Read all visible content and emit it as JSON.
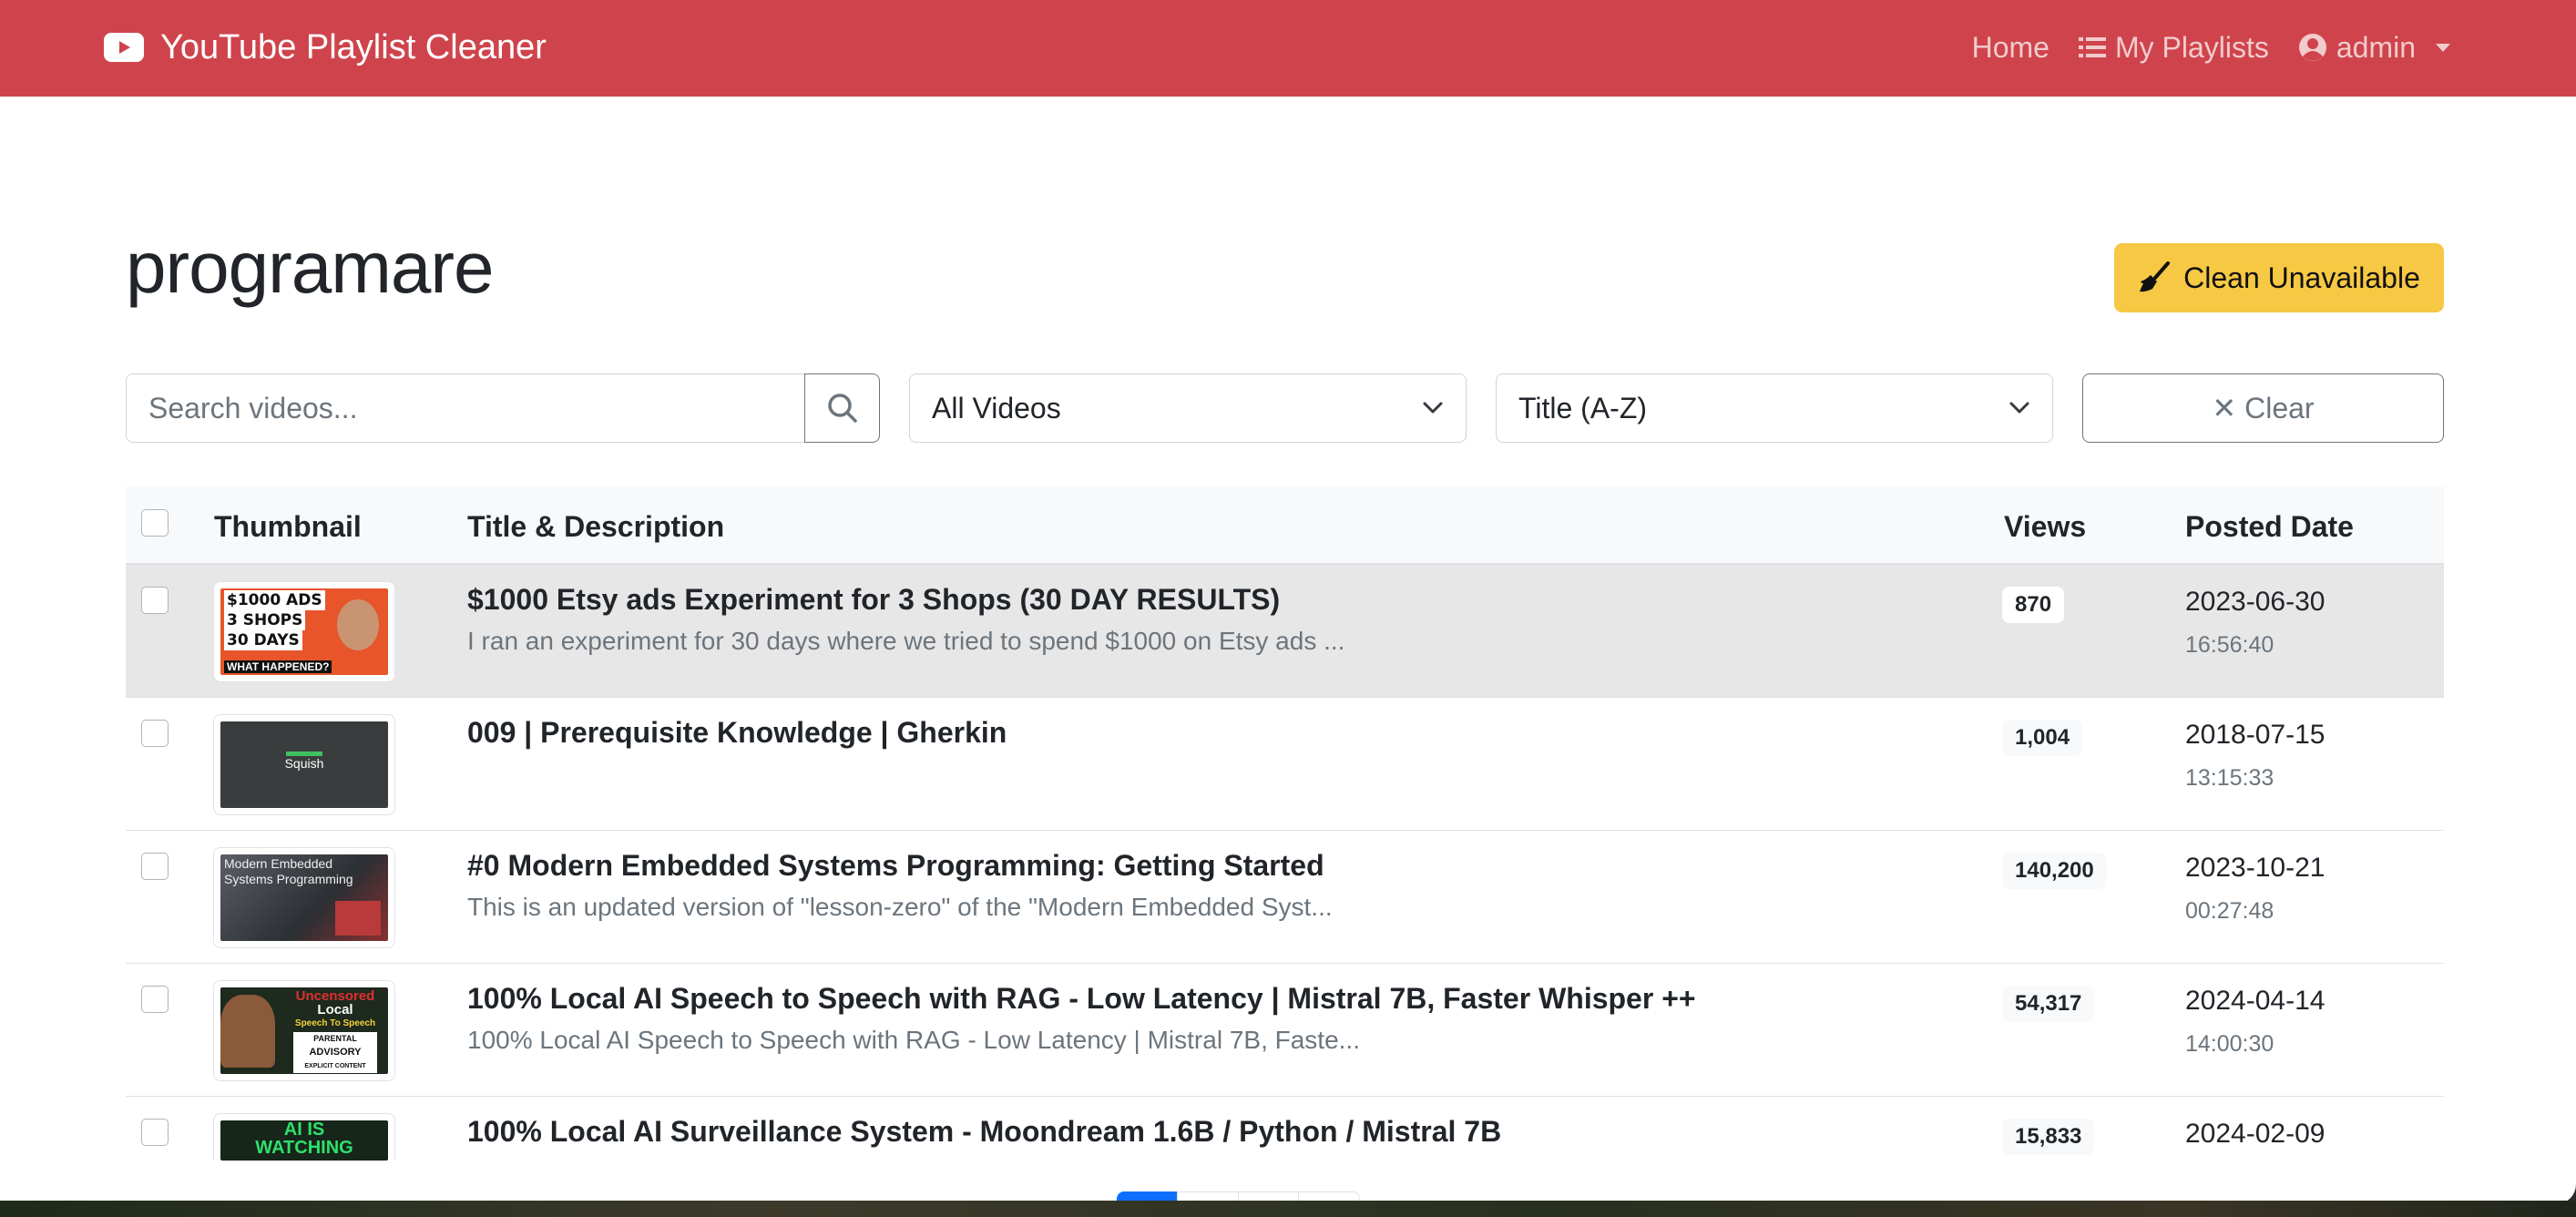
{
  "navbar": {
    "brand": "YouTube Playlist Cleaner",
    "home": "Home",
    "playlists": "My Playlists",
    "user": "admin"
  },
  "page": {
    "title": "programare",
    "clean_button": "Clean Unavailable"
  },
  "filters": {
    "search_placeholder": "Search videos...",
    "video_filter": "All Videos",
    "sort": "Title (A-Z)",
    "clear_button": "✕ Clear"
  },
  "table": {
    "headers": {
      "thumbnail": "Thumbnail",
      "title": "Title & Description",
      "views": "Views",
      "date": "Posted Date"
    },
    "rows": [
      {
        "title": "$1000 Etsy ads Experiment for 3 Shops (30 DAY RESULTS)",
        "description": "I ran an experiment for 30 days where we tried to spend $1000 on Etsy ads ...",
        "views": "870",
        "date": "2023-06-30",
        "time": "16:56:40",
        "thumb_text": [
          "$1000 ADS",
          "3 SHOPS",
          "30 DAYS",
          "WHAT HAPPENED?"
        ]
      },
      {
        "title": "009 | Prerequisite Knowledge | Gherkin",
        "description": "",
        "views": "1,004",
        "date": "2018-07-15",
        "time": "13:15:33",
        "thumb_text": [
          "Squish"
        ]
      },
      {
        "title": "#0 Modern Embedded Systems Programming: Getting Started",
        "description": "This is an updated version of \"lesson-zero\" of the \"Modern Embedded Syst...",
        "views": "140,200",
        "date": "2023-10-21",
        "time": "00:27:48",
        "thumb_text": [
          "Modern Embedded",
          "Systems Programming"
        ]
      },
      {
        "title": "100% Local AI Speech to Speech with RAG - Low Latency | Mistral 7B, Faster Whisper ++",
        "description": "100% Local AI Speech to Speech with RAG - Low Latency | Mistral 7B, Faste...",
        "views": "54,317",
        "date": "2024-04-14",
        "time": "14:00:30",
        "thumb_text": [
          "Uncensored",
          "Local",
          "Speech To Speech",
          "PARENTAL",
          "ADVISORY",
          "EXPLICIT CONTENT"
        ]
      },
      {
        "title": "100% Local AI Surveillance System - Moondream 1.6B / Python / Mistral 7B",
        "description": "",
        "views": "15,833",
        "date": "2024-02-09",
        "time": "",
        "thumb_text": [
          "AI IS",
          "WATCHING"
        ]
      }
    ]
  },
  "colors": {
    "navbar": "#cf444c",
    "clean_button": "#f7c843",
    "pagination_active": "#0d6efd"
  }
}
